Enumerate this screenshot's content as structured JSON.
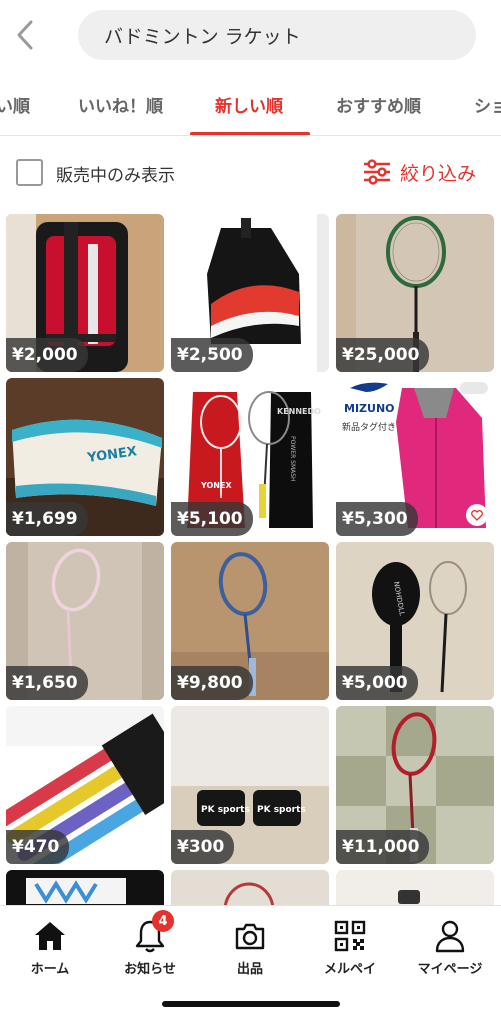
{
  "search": {
    "query": "バドミントン ラケット"
  },
  "tabs": [
    {
      "label": "い順"
    },
    {
      "label": "いいね！順"
    },
    {
      "label": "新しい順",
      "active": true
    },
    {
      "label": "おすすめ順"
    },
    {
      "label": "ショ"
    }
  ],
  "filter": {
    "checkbox_label": "販売中のみ表示",
    "refine_label": "絞り込み"
  },
  "items": [
    {
      "price": "¥2,000"
    },
    {
      "price": "¥2,500"
    },
    {
      "price": "¥25,000"
    },
    {
      "price": "¥1,699",
      "print": [
        "YONEX"
      ]
    },
    {
      "price": "¥5,100",
      "print": [
        "YONEX",
        "KENNEDO",
        "POWER SMASH"
      ]
    },
    {
      "price": "¥5,300",
      "print": [
        "MIZUNO",
        "新品タグ付き"
      ]
    },
    {
      "price": "¥1,650"
    },
    {
      "price": "¥9,800"
    },
    {
      "price": "¥5,000",
      "print": [
        "NOHDDLL"
      ]
    },
    {
      "price": "¥470"
    },
    {
      "price": "¥300",
      "print": [
        "PK sports",
        "PK sports"
      ]
    },
    {
      "price": "¥11,000"
    }
  ],
  "nav": {
    "home": "ホーム",
    "notifications": "お知らせ",
    "notification_count": "4",
    "sell": "出品",
    "merpay": "メルペイ",
    "mypage": "マイページ"
  },
  "colors": {
    "accent": "#e5322d",
    "tab_inactive": "#666666"
  }
}
